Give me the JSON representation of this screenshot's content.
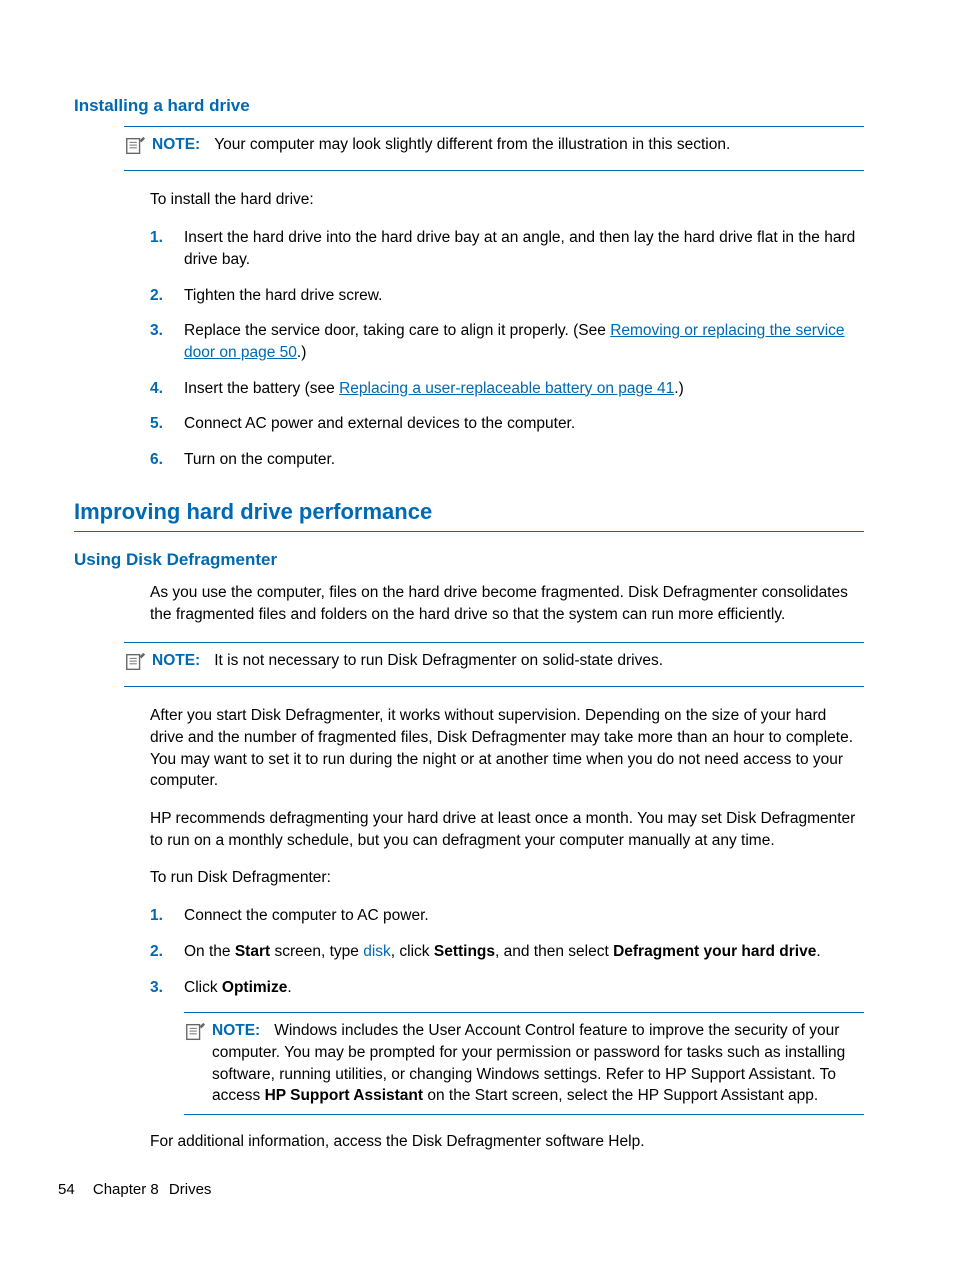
{
  "section1": {
    "heading": "Installing a hard drive",
    "note_label": "NOTE:",
    "note_text": "Your computer may look slightly different from the illustration in this section.",
    "intro": "To install the hard drive:",
    "steps": [
      {
        "n": "1.",
        "pre": "Insert the hard drive into the hard drive bay at an angle, and then lay the hard drive flat in the hard drive bay."
      },
      {
        "n": "2.",
        "pre": "Tighten the hard drive screw."
      },
      {
        "n": "3.",
        "pre": "Replace the service door, taking care to align it properly. (See ",
        "link": "Removing or replacing the service door on page 50",
        "post": ".)"
      },
      {
        "n": "4.",
        "pre": "Insert the battery (see ",
        "link": "Replacing a user-replaceable battery on page 41",
        "post": ".)"
      },
      {
        "n": "5.",
        "pre": "Connect AC power and external devices to the computer."
      },
      {
        "n": "6.",
        "pre": "Turn on the computer."
      }
    ]
  },
  "section2": {
    "main_heading": "Improving hard drive performance",
    "sub_heading": "Using Disk Defragmenter",
    "para1": "As you use the computer, files on the hard drive become fragmented. Disk Defragmenter consolidates the fragmented files and folders on the hard drive so that the system can run more efficiently.",
    "note_label": "NOTE:",
    "note_text": "It is not necessary to run Disk Defragmenter on solid-state drives.",
    "para2": "After you start Disk Defragmenter, it works without supervision. Depending on the size of your hard drive and the number of fragmented files, Disk Defragmenter may take more than an hour to complete. You may want to set it to run during the night or at another time when you do not need access to your computer.",
    "para3": "HP recommends defragmenting your hard drive at least once a month. You may set Disk Defragmenter to run on a monthly schedule, but you can defragment your computer manually at any time.",
    "para4": "To run Disk Defragmenter:",
    "steps": {
      "s1n": "1.",
      "s1t": "Connect the computer to AC power.",
      "s2n": "2.",
      "s2_a": "On the ",
      "s2_b": "Start",
      "s2_c": " screen, type ",
      "s2_d": "disk",
      "s2_e": ", click ",
      "s2_f": "Settings",
      "s2_g": ", and then select ",
      "s2_h": "Defragment your hard drive",
      "s2_i": ".",
      "s3n": "3.",
      "s3_a": "Click ",
      "s3_b": "Optimize",
      "s3_c": "."
    },
    "note2_label": "NOTE:",
    "note2_a": "Windows includes the User Account Control feature to improve the security of your computer. You may be prompted for your permission or password for tasks such as installing software, running utilities, or changing Windows settings. Refer to HP Support Assistant. To access ",
    "note2_b": "HP Support Assistant",
    "note2_c": " on the Start screen, select the HP Support Assistant app.",
    "para5": "For additional information, access the Disk Defragmenter software Help."
  },
  "footer": {
    "page": "54",
    "chapter": "Chapter 8",
    "title": "Drives"
  }
}
